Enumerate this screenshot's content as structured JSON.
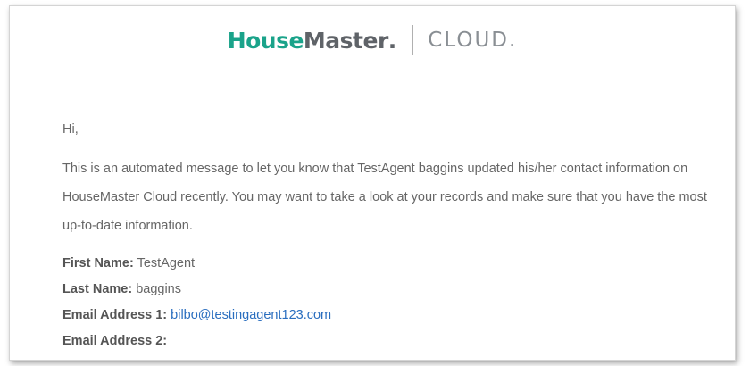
{
  "header": {
    "logo_house": "House",
    "logo_master": "Master",
    "logo_dot": ".",
    "logo_cloud": "CLOUD."
  },
  "email": {
    "greeting": "Hi,",
    "message": "This is an automated message to let you know that TestAgent baggins updated his/her contact information on HouseMaster Cloud recently. You may want to take a look at your records and make sure that you have the most up-to-date information.",
    "fields": [
      {
        "label": "First Name:",
        "value": "TestAgent"
      },
      {
        "label": "Last Name:",
        "value": "baggins"
      },
      {
        "label": "Email Address 1:",
        "value": "bilbo@testingagent123.com"
      },
      {
        "label": "Email Address 2:",
        "value": ""
      }
    ]
  },
  "colors": {
    "brand_green": "#1aa38a",
    "brand_gray": "#5f6368",
    "link": "#2a6ebf"
  }
}
